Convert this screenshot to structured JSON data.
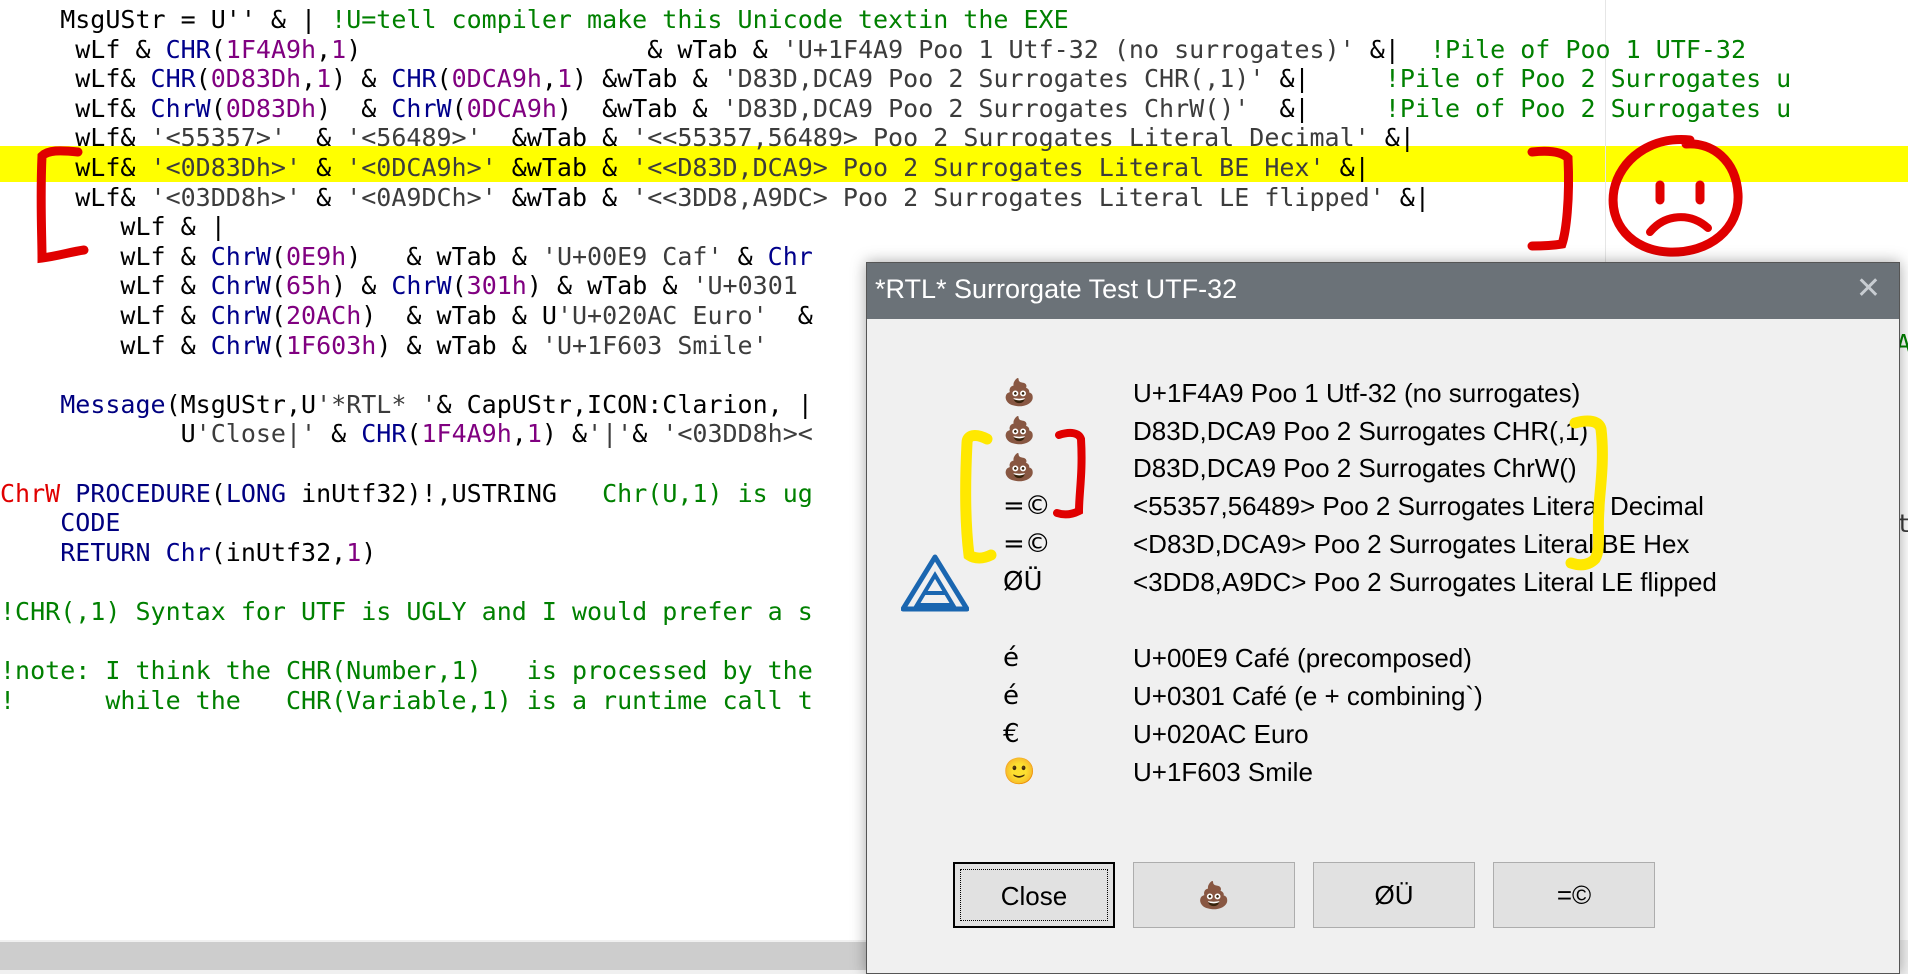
{
  "code_lines": [
    [
      [
        "t",
        "    MsgUStr = U'' & | "
      ],
      [
        "c",
        "!U=tell compiler make this Unicode textin the EXE"
      ]
    ],
    [
      [
        "t",
        "     wLf & "
      ],
      [
        "f",
        "CHR"
      ],
      [
        "t",
        "("
      ],
      [
        "n",
        "1F4A9h"
      ],
      [
        "t",
        ","
      ],
      [
        "n",
        "1"
      ],
      [
        "t",
        ")                   & wTab & "
      ],
      [
        "s",
        "'U+1F4A9 Poo 1 Utf-32 (no surrogates)'"
      ],
      [
        "t",
        " &|  "
      ],
      [
        "c",
        "!Pile of Poo 1 UTF-32"
      ]
    ],
    [
      [
        "t",
        "     wLf& "
      ],
      [
        "f",
        "CHR"
      ],
      [
        "t",
        "("
      ],
      [
        "n",
        "0D83Dh"
      ],
      [
        "t",
        ","
      ],
      [
        "n",
        "1"
      ],
      [
        "t",
        ") & "
      ],
      [
        "f",
        "CHR"
      ],
      [
        "t",
        "("
      ],
      [
        "n",
        "0DCA9h"
      ],
      [
        "t",
        ","
      ],
      [
        "n",
        "1"
      ],
      [
        "t",
        ") &wTab & "
      ],
      [
        "s",
        "'D83D,DCA9 Poo 2 Surrogates CHR(,1)'"
      ],
      [
        "t",
        " &|     "
      ],
      [
        "c",
        "!Pile of Poo 2 Surrogates u"
      ]
    ],
    [
      [
        "t",
        "     wLf& "
      ],
      [
        "f",
        "ChrW"
      ],
      [
        "t",
        "("
      ],
      [
        "n",
        "0D83Dh"
      ],
      [
        "t",
        ")  & "
      ],
      [
        "f",
        "ChrW"
      ],
      [
        "t",
        "("
      ],
      [
        "n",
        "0DCA9h"
      ],
      [
        "t",
        ")  &wTab & "
      ],
      [
        "s",
        "'D83D,DCA9 Poo 2 Surrogates ChrW()'"
      ],
      [
        "t",
        "  &|     "
      ],
      [
        "c",
        "!Pile of Poo 2 Surrogates u"
      ]
    ],
    [
      [
        "t",
        "     wLf& "
      ],
      [
        "s",
        "'<55357>'"
      ],
      [
        "t",
        "  & "
      ],
      [
        "s",
        "'<56489>'"
      ],
      [
        "t",
        "  &wTab & "
      ],
      [
        "s",
        "'<<55357,56489> Poo 2 Surrogates Literal Decimal'"
      ],
      [
        "t",
        " &|"
      ]
    ],
    [
      [
        "t",
        "     wLf& "
      ],
      [
        "s",
        "'<0D83Dh>'"
      ],
      [
        "t",
        " & "
      ],
      [
        "s",
        "'<0DCA9h>'"
      ],
      [
        "t",
        " &wTab & "
      ],
      [
        "s",
        "'<<D83D,DCA9> Poo 2 Surrogates Literal BE Hex'"
      ],
      [
        "t",
        " &|"
      ]
    ],
    [
      [
        "t",
        "     wLf& "
      ],
      [
        "s",
        "'<03DD8h>'"
      ],
      [
        "t",
        " & "
      ],
      [
        "s",
        "'<0A9DCh>'"
      ],
      [
        "t",
        " &wTab & "
      ],
      [
        "s",
        "'<<3DD8,A9DC> Poo 2 Surrogates Literal LE flipped'"
      ],
      [
        "t",
        " &|"
      ]
    ],
    [
      [
        "t",
        "        wLf & |"
      ]
    ],
    [
      [
        "t",
        "        wLf & "
      ],
      [
        "f",
        "ChrW"
      ],
      [
        "t",
        "("
      ],
      [
        "n",
        "0E9h"
      ],
      [
        "t",
        ")   & wTab & "
      ],
      [
        "s",
        "'U+00E9 Caf'"
      ],
      [
        "t",
        " & "
      ],
      [
        "f",
        "Chr"
      ]
    ],
    [
      [
        "t",
        "        wLf & "
      ],
      [
        "f",
        "ChrW"
      ],
      [
        "t",
        "("
      ],
      [
        "n",
        "65h"
      ],
      [
        "t",
        ") & "
      ],
      [
        "f",
        "ChrW"
      ],
      [
        "t",
        "("
      ],
      [
        "n",
        "301h"
      ],
      [
        "t",
        ") & wTab & "
      ],
      [
        "s",
        "'U+0301"
      ]
    ],
    [
      [
        "t",
        "        wLf & "
      ],
      [
        "f",
        "ChrW"
      ],
      [
        "t",
        "("
      ],
      [
        "n",
        "20ACh"
      ],
      [
        "t",
        ")  & wTab & U"
      ],
      [
        "s",
        "'U+020AC Euro'"
      ],
      [
        "t",
        "  &"
      ]
    ],
    [
      [
        "t",
        "        wLf & "
      ],
      [
        "f",
        "ChrW"
      ],
      [
        "t",
        "("
      ],
      [
        "n",
        "1F603h"
      ],
      [
        "t",
        ") & wTab & "
      ],
      [
        "s",
        "'U+1F603 Smile'"
      ]
    ],
    [
      [
        "t",
        ""
      ]
    ],
    [
      [
        "t",
        "    "
      ],
      [
        "k",
        "Message"
      ],
      [
        "t",
        "(MsgUStr,U"
      ],
      [
        "s",
        "'*RTL* '"
      ],
      [
        "t",
        "& CapUStr,ICON:Clarion, |"
      ]
    ],
    [
      [
        "t",
        "            U"
      ],
      [
        "s",
        "'Close|'"
      ],
      [
        "t",
        " & "
      ],
      [
        "f",
        "CHR"
      ],
      [
        "t",
        "("
      ],
      [
        "n",
        "1F4A9h"
      ],
      [
        "t",
        ","
      ],
      [
        "n",
        "1"
      ],
      [
        "t",
        ") &"
      ],
      [
        "s",
        "'|'"
      ],
      [
        "t",
        "& "
      ],
      [
        "s",
        "'<03DD8h><"
      ]
    ],
    [
      [
        "t",
        ""
      ]
    ],
    [
      [
        "r",
        "ChrW"
      ],
      [
        "t",
        " "
      ],
      [
        "k",
        "PROCEDURE"
      ],
      [
        "t",
        "("
      ],
      [
        "k",
        "LONG"
      ],
      [
        "t",
        " inUtf32)!,USTRING   "
      ],
      [
        "c",
        "Chr(U,1) is ug"
      ]
    ],
    [
      [
        "t",
        "    "
      ],
      [
        "k",
        "CODE"
      ]
    ],
    [
      [
        "t",
        "    "
      ],
      [
        "k",
        "RETURN"
      ],
      [
        "t",
        " "
      ],
      [
        "f",
        "Chr"
      ],
      [
        "t",
        "(inUtf32,"
      ],
      [
        "n",
        "1"
      ],
      [
        "t",
        ")"
      ]
    ],
    [
      [
        "t",
        ""
      ]
    ],
    [
      [
        "c",
        "!CHR(,1) Syntax for UTF is UGLY and I would prefer a s"
      ]
    ],
    [
      [
        "t",
        ""
      ]
    ],
    [
      [
        "c",
        "!note: I think the CHR(Number,1)   is processed by the"
      ]
    ],
    [
      [
        "c",
        "!      while the   CHR(Variable,1) is a runtime call t"
      ]
    ]
  ],
  "right_edge_chars": {
    "line9": "A",
    "line15": "t"
  },
  "dialog": {
    "title": "*RTL* Surrorgate Test UTF-32",
    "close_glyph": "✕",
    "icon": "clarion-logo-icon",
    "lines": [
      {
        "glyph": "💩",
        "text": "U+1F4A9 Poo 1 Utf-32 (no surrogates)"
      },
      {
        "glyph": "💩",
        "text": "D83D,DCA9 Poo 2 Surrogates CHR(,1)"
      },
      {
        "glyph": "💩",
        "text": "D83D,DCA9 Poo 2 Surrogates ChrW()"
      },
      {
        "glyph": "=©",
        "text": "<55357,56489> Poo 2 Surrogates Literal Decimal"
      },
      {
        "glyph": "=©",
        "text": "<D83D,DCA9> Poo 2 Surrogates Literal BE Hex"
      },
      {
        "glyph": "ØÜ",
        "text": "<3DD8,A9DC> Poo 2 Surrogates Literal LE flipped"
      },
      {
        "glyph": "é",
        "text": "U+00E9 Café (precomposed)"
      },
      {
        "glyph": "é",
        "text": "U+0301 Café (e + combining`)"
      },
      {
        "glyph": "€",
        "text": "U+020AC Euro"
      },
      {
        "glyph": "🙂",
        "text": "U+1F603 Smile"
      }
    ],
    "buttons": [
      "Close",
      "💩",
      "ØÜ",
      "=©"
    ]
  },
  "colors": {
    "highlight": "#ffff00",
    "annotation_red": "#e00000",
    "annotation_yellow": "#ffe800",
    "titlebar": "#6b7278"
  }
}
